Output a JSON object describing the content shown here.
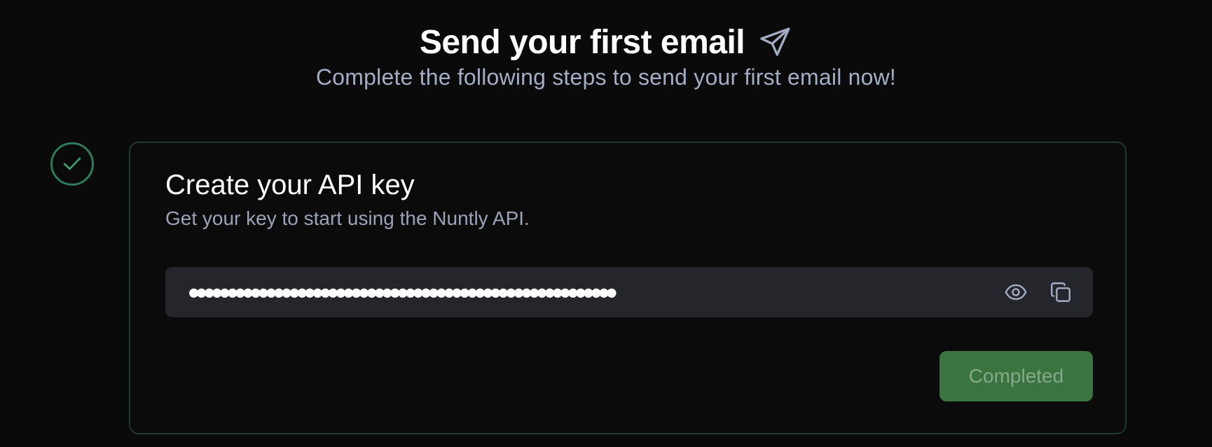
{
  "header": {
    "title": "Send your first email",
    "title_icon": "paper-plane-icon",
    "subtitle": "Complete the following steps to send your first email now!"
  },
  "step": {
    "status_icon": "check-icon",
    "status": "completed",
    "title": "Create your API key",
    "description": "Get your key to start using the Nuntly API.",
    "api_key_masked": "●●●●●●●●●●●●●●●●●●●●●●●●●●●●●●●●●●●●●●●●●●●●●●●●●●●●●●●",
    "reveal_icon": "eye-icon",
    "copy_icon": "copy-icon",
    "button_label": "Completed"
  },
  "colors": {
    "background": "#0a0a0a",
    "card_border": "#1d3b2d",
    "success_ring": "#2f7a58",
    "success_check": "#3aa36f",
    "field_bg": "#24262b",
    "button_bg": "#3a7440",
    "button_text": "#86a98a",
    "muted_text": "#9aa3b8"
  }
}
